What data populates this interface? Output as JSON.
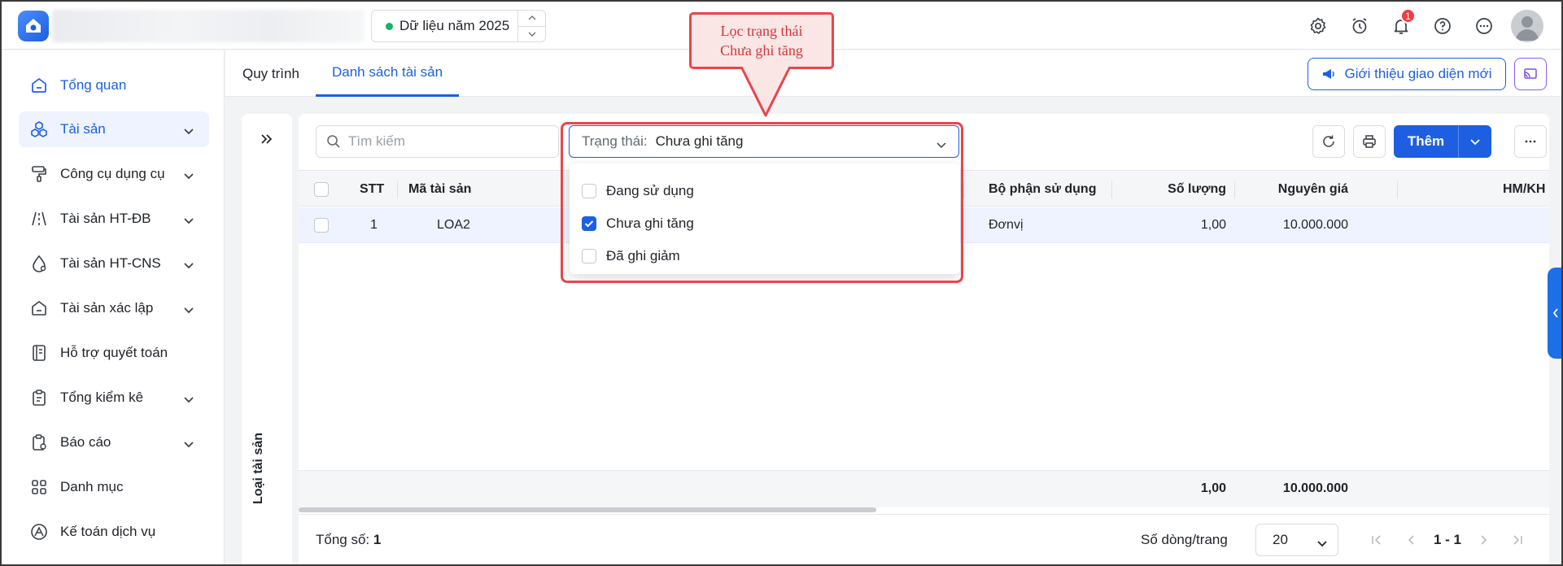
{
  "header": {
    "year_label": "Dữ liệu năm 2025",
    "notification_count": "1"
  },
  "sidebar": {
    "items": [
      {
        "label": "Tổng quan"
      },
      {
        "label": "Tài sản"
      },
      {
        "label": "Công cụ dụng cụ"
      },
      {
        "label": "Tài sản HT-ĐB"
      },
      {
        "label": "Tài sản HT-CNS"
      },
      {
        "label": "Tài sản xác lập"
      },
      {
        "label": "Hỗ trợ quyết toán"
      },
      {
        "label": "Tổng kiểm kê"
      },
      {
        "label": "Báo cáo"
      },
      {
        "label": "Danh mục"
      },
      {
        "label": "Kế toán dịch vụ"
      }
    ]
  },
  "tabs": [
    {
      "label": "Quy trình"
    },
    {
      "label": "Danh sách tài sản"
    }
  ],
  "intro_button": "Giới thiệu giao diện mới",
  "left_panel": {
    "label": "Loại tài sản"
  },
  "toolbar": {
    "search_placeholder": "Tìm kiếm",
    "status_label": "Trạng thái:",
    "status_value": "Chưa ghi tăng",
    "add_label": "Thêm"
  },
  "table": {
    "columns": [
      "STT",
      "Mã tài sản",
      "Bộ phận sử dụng",
      "Số lượng",
      "Nguyên giá",
      "HM/KH"
    ],
    "rows": [
      {
        "stt": "1",
        "code": "LOA2",
        "dept": "Đơnvị",
        "qty": "1,00",
        "cost": "10.000.000"
      }
    ],
    "footer": {
      "qty": "1,00",
      "cost": "10.000.000"
    }
  },
  "pager": {
    "total_label": "Tổng số:",
    "total_value": "1",
    "rows_label": "Số dòng/trang",
    "rows_value": "20",
    "range": "1 - 1"
  },
  "status_options": [
    {
      "label": "Đang sử dụng",
      "checked": false
    },
    {
      "label": "Chưa ghi tăng",
      "checked": true
    },
    {
      "label": "Đã ghi giảm",
      "checked": false
    }
  ],
  "callout": {
    "line1": "Lọc trạng thái",
    "line2": "Chưa ghi tăng"
  },
  "colors": {
    "primary": "#1d5fe0",
    "callout_red": "#e8464a",
    "active_dot": "#16b364"
  }
}
